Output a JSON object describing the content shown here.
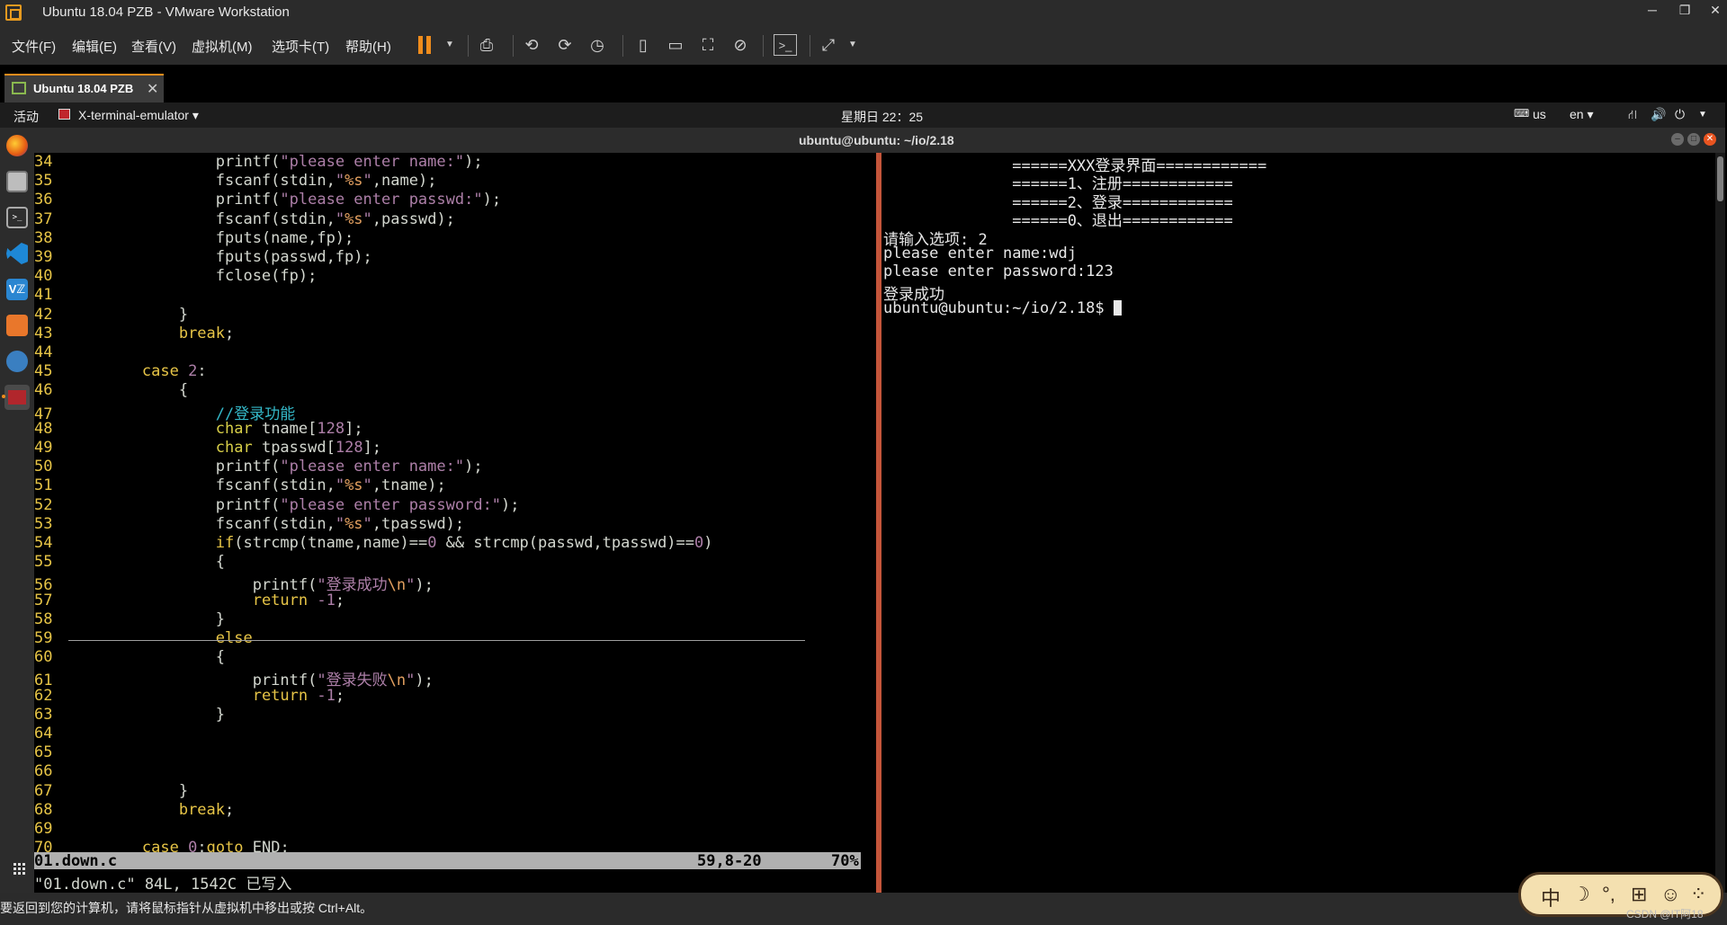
{
  "window": {
    "title": "Ubuntu 18.04 PZB - VMware Workstation",
    "controls": {
      "minimize": "─",
      "restore": "❐",
      "close": "✕"
    }
  },
  "menubar": {
    "items": [
      "文件(F)",
      "编辑(E)",
      "查看(V)",
      "虚拟机(M)",
      "选项卡(T)",
      "帮助(H)"
    ],
    "accent": "#ef8c1c"
  },
  "tab": {
    "label": "Ubuntu 18.04 PZB",
    "close": "✕"
  },
  "gnome": {
    "activities": "活动",
    "app_menu": "X-terminal-emulator ▾",
    "clock": "星期日 22：25",
    "keyboard": "us",
    "lang": "en ▾",
    "tray_icons": [
      "network-icon",
      "volume-icon",
      "power-icon"
    ]
  },
  "terminal": {
    "title": "ubuntu@ubuntu: ~/io/2.18",
    "title_buttons": [
      "–",
      "□",
      "✕"
    ]
  },
  "vim": {
    "lines": [
      {
        "n": "34",
        "code": "printf(\"please enter name:\");"
      },
      {
        "n": "35",
        "code": "fscanf(stdin,\"%s\",name);"
      },
      {
        "n": "36",
        "code": "printf(\"please enter passwd:\");"
      },
      {
        "n": "37",
        "code": "fscanf(stdin,\"%s\",passwd);"
      },
      {
        "n": "38",
        "code": "fputs(name,fp);"
      },
      {
        "n": "39",
        "code": "fputs(passwd,fp);"
      },
      {
        "n": "40",
        "code": "fclose(fp);"
      },
      {
        "n": "41",
        "code": ""
      },
      {
        "n": "42",
        "code": "}"
      },
      {
        "n": "43",
        "code": "break;"
      },
      {
        "n": "44",
        "code": ""
      },
      {
        "n": "45",
        "code": "case 2:"
      },
      {
        "n": "46",
        "code": "{"
      },
      {
        "n": "47",
        "code": "//登录功能"
      },
      {
        "n": "48",
        "code": "char tname[128];"
      },
      {
        "n": "49",
        "code": "char tpasswd[128];"
      },
      {
        "n": "50",
        "code": "printf(\"please enter name:\");"
      },
      {
        "n": "51",
        "code": "fscanf(stdin,\"%s\",tname);"
      },
      {
        "n": "52",
        "code": "printf(\"please enter password:\");"
      },
      {
        "n": "53",
        "code": "fscanf(stdin,\"%s\",tpasswd);"
      },
      {
        "n": "54",
        "code": "if(strcmp(tname,name)==0 && strcmp(passwd,tpasswd)==0)"
      },
      {
        "n": "55",
        "code": "{"
      },
      {
        "n": "56",
        "code": "printf(\"登录成功\\n\");"
      },
      {
        "n": "57",
        "code": "return -1;"
      },
      {
        "n": "58",
        "code": "}"
      },
      {
        "n": "59",
        "code": "else"
      },
      {
        "n": "60",
        "code": "{"
      },
      {
        "n": "61",
        "code": "printf(\"登录失败\\n\");"
      },
      {
        "n": "62",
        "code": "return -1;"
      },
      {
        "n": "63",
        "code": "}"
      },
      {
        "n": "64",
        "code": ""
      },
      {
        "n": "65",
        "code": ""
      },
      {
        "n": "66",
        "code": ""
      },
      {
        "n": "67",
        "code": "}"
      },
      {
        "n": "68",
        "code": "break;"
      },
      {
        "n": "69",
        "code": ""
      },
      {
        "n": "70",
        "code": "case 0:goto END;"
      }
    ],
    "status": {
      "file": "01.down.c",
      "position": "59,8-20",
      "percent": "70%"
    },
    "message": "\"01.down.c\" 84L, 1542C 已写入"
  },
  "shell": {
    "lines": [
      "              ======XXX登录界面============",
      "              ======1、注册============",
      "              ======2、登录============",
      "              ======0、退出============",
      "请输入选项: 2",
      "please enter name:wdj",
      "please enter password:123",
      "登录成功"
    ],
    "prompt": "ubuntu@ubuntu:~/io/2.18$ "
  },
  "statusbar": {
    "hint": "要返回到您的计算机，请将鼠标指针从虚拟机中移出或按 Ctrl+Alt。",
    "ime": [
      "中",
      "☽",
      "°,",
      "⊞",
      "☺",
      "⁘"
    ],
    "watermark": "CSDN @IT阿18"
  }
}
